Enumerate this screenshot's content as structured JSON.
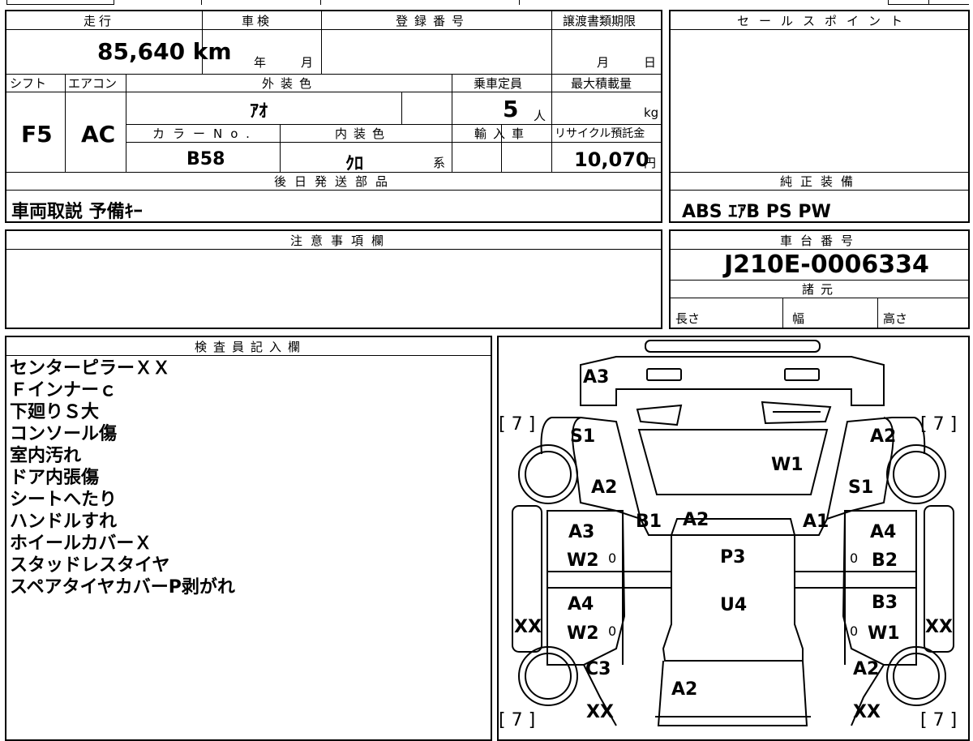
{
  "top_strip": [
    "",
    "",
    "",
    "",
    ""
  ],
  "vehicle": {
    "mileage_label": "走行",
    "mileage": "85,640 km",
    "inspection_label": "車検",
    "inspection_year_unit": "年",
    "inspection_month_unit": "月",
    "reg_label": "登録番号",
    "deadline_label": "譲渡書類期限",
    "deadline_month_unit": "月",
    "deadline_day_unit": "日",
    "shift_label": "シフト",
    "shift": "F5",
    "ac_label": "エアコン",
    "ac": "AC",
    "exterior_label": "外装色",
    "exterior": "ｱｵ",
    "capacity_label": "乗車定員",
    "capacity": "5",
    "capacity_unit": "人",
    "maxload_label": "最大積載量",
    "maxload_unit": "kg",
    "color_no_label": "カラーNo.",
    "color_no": "B58",
    "interior_label": "内装色",
    "interior": "ｸﾛ",
    "interior_unit": "系",
    "import_label": "輸入車",
    "recycle_label": "リサイクル預託金",
    "recycle": "10,070",
    "recycle_unit": "円",
    "later_parts_label": "後日発送部品",
    "later_parts": "車両取説 予備ｷｰ"
  },
  "sales": {
    "sales_point_label": "セールスポイント",
    "genuine_label": "純正装備",
    "genuine": "ABS ｴｱB PS PW"
  },
  "caution_label": "注意事項欄",
  "chassis_label": "車台番号",
  "chassis": "J210E-0006334",
  "specs_label": "諸元",
  "specs": {
    "length": "長さ",
    "width": "幅",
    "height": "高さ"
  },
  "inspector": {
    "label": "検査員記入欄",
    "notes": [
      "センターピラーＸＸ",
      "Ｆインナーｃ",
      "下廻りＳ大",
      "コンソール傷",
      "室内汚れ",
      "ドア内張傷",
      "シートへたり",
      "ハンドルすれ",
      "ホイールカバーＸ",
      "スタッドレスタイヤ",
      "スペアタイヤカバーP剥がれ"
    ]
  },
  "diagram": {
    "codes": {
      "rear": "A3",
      "s1_left": "S1",
      "a2_front_right": "A2",
      "w1": "W1",
      "a2_left_fender": "A2",
      "s1_right": "S1",
      "b1": "B1",
      "a2_hood": "A2",
      "a1": "A1",
      "a3_left_door": "A3",
      "a4_right_door": "A4",
      "w2_upper": "W2",
      "p3": "P3",
      "b2": "B2",
      "a4_left_rear": "A4",
      "u4": "U4",
      "b3": "B3",
      "xx_left": "XX",
      "w2_lower": "W2",
      "w1_lower": "W1",
      "xx_right": "XX",
      "c3": "C3",
      "a2_right_lower": "A2",
      "a2_bottom": "A2",
      "xx_bottom_left": "XX",
      "xx_bottom_right": "XX"
    },
    "zeros": [
      "0",
      "0",
      "0",
      "0"
    ],
    "tire_tl": "[ 7 ]",
    "tire_tr": "[ 7 ]",
    "tire_bl": "[ 7 ]",
    "tire_br": "[ 7 ]"
  }
}
